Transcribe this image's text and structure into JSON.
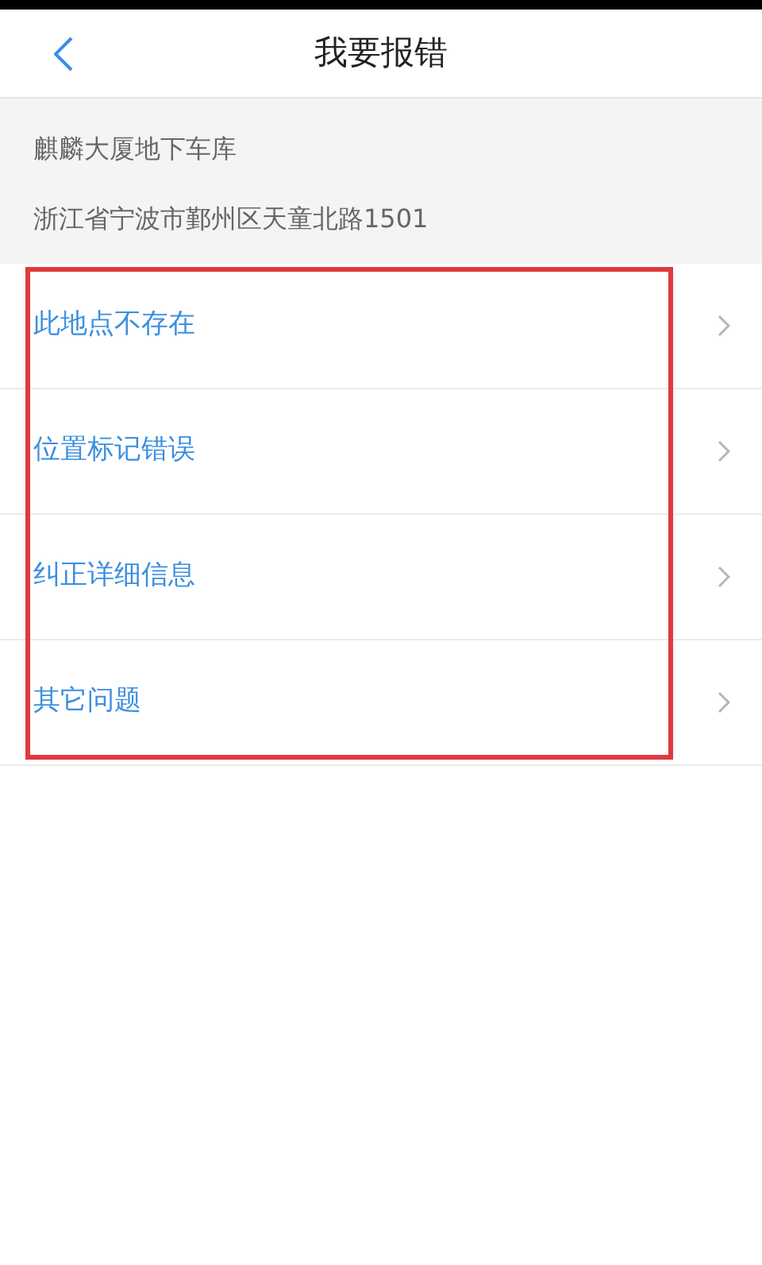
{
  "header": {
    "title": "我要报错"
  },
  "place": {
    "name": "麒麟大厦地下车库",
    "address": "浙江省宁波市鄞州区天童北路1501"
  },
  "options": [
    {
      "label": "此地点不存在"
    },
    {
      "label": "位置标记错误"
    },
    {
      "label": "纠正详细信息"
    },
    {
      "label": "其它问题"
    }
  ],
  "highlight": {
    "color": "#e0393e"
  }
}
